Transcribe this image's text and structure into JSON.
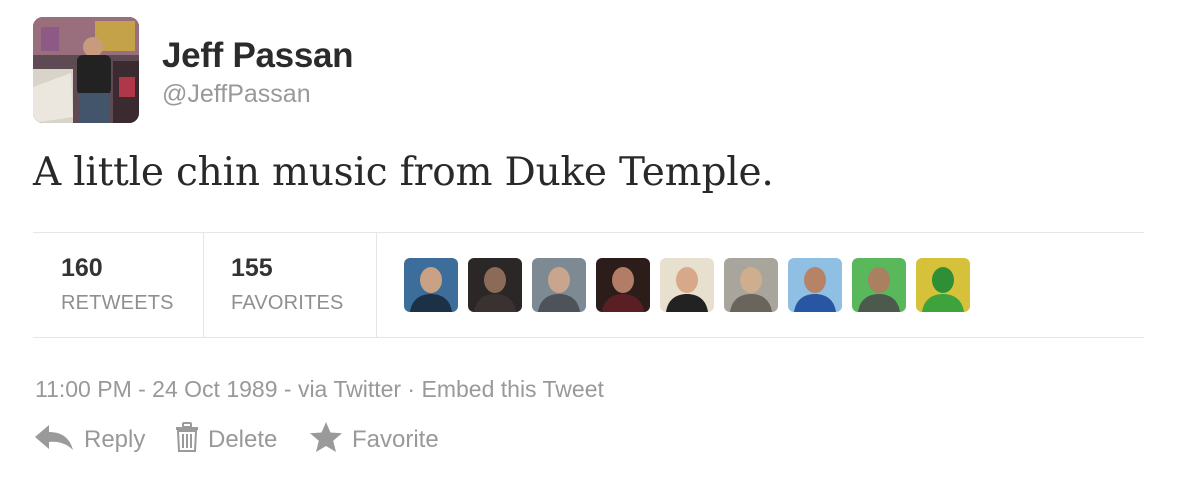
{
  "user": {
    "name": "Jeff Passan",
    "screen_name": "@JeffPassan"
  },
  "tweet": {
    "text": "A little chin music from Duke Temple."
  },
  "stats": {
    "retweets": {
      "count": "160",
      "label": "RETWEETS"
    },
    "favorites": {
      "count": "155",
      "label": "FAVORITES"
    }
  },
  "faces": [
    {
      "bg": "#3d6d9a",
      "skin": "#c9a184",
      "shirt": "#1d3146"
    },
    {
      "bg": "#2a2726",
      "skin": "#8c6a58",
      "shirt": "#3a3230"
    },
    {
      "bg": "#7d8a93",
      "skin": "#caa58e",
      "shirt": "#4d5358"
    },
    {
      "bg": "#2c1c1a",
      "skin": "#b17d66",
      "shirt": "#5a1f24"
    },
    {
      "bg": "#e7e0cf",
      "skin": "#d8a88a",
      "shirt": "#222222"
    },
    {
      "bg": "#a7a59c",
      "skin": "#cfae8e",
      "shirt": "#6a655c"
    },
    {
      "bg": "#8fc0e3",
      "skin": "#b68366",
      "shirt": "#2956a3"
    },
    {
      "bg": "#5ab85c",
      "skin": "#a98060",
      "shirt": "#4b5a4c"
    },
    {
      "bg": "#d6c23a",
      "skin": "#2f8f36",
      "shirt": "#3ea33c"
    }
  ],
  "meta": {
    "timestamp": "11:00 PM - 24 Oct 1989",
    "via": " - via Twitter",
    "separator": " · ",
    "embed_label": "Embed this Tweet"
  },
  "actions": {
    "reply_label": "Reply",
    "delete_label": "Delete",
    "favorite_label": "Favorite"
  },
  "colors": {
    "meta_text": "#999999",
    "icon": "#9a9a9a",
    "divider": "#e6e6e6"
  },
  "icons": {
    "reply": "reply-arrow-icon",
    "delete": "trash-icon",
    "favorite": "star-icon"
  }
}
